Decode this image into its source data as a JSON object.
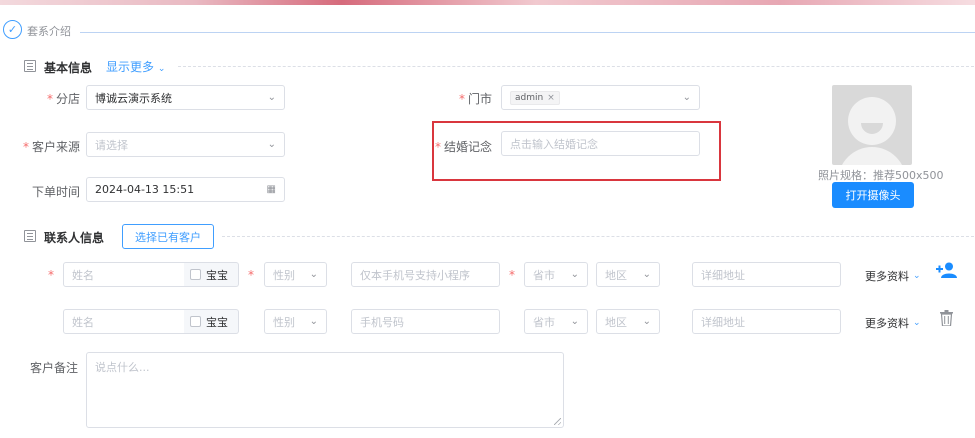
{
  "section": {
    "title": "套系介绍",
    "check_icon": "check-icon"
  },
  "basic": {
    "title": "基本信息",
    "show_more": "显示更多",
    "branch": {
      "label": "分店",
      "value": "博诚云演示系统"
    },
    "store": {
      "label": "门市",
      "tag": "admin",
      "tag_close": "×"
    },
    "source": {
      "label": "客户来源",
      "placeholder": "请选择"
    },
    "anniversary": {
      "label": "结婚记念",
      "placeholder": "点击输入结婚记念"
    },
    "order_time": {
      "label": "下单时间",
      "value": "2024-04-13 15:51"
    },
    "photo_spec": "照片规格：推荐500x500",
    "camera_button": "打开摄像头"
  },
  "contact": {
    "title": "联系人信息",
    "select_existing": "选择已有客户",
    "rows": [
      {
        "name_placeholder": "姓名",
        "baby_label": "宝宝",
        "gender_placeholder": "性别",
        "phone_placeholder": "仅本手机号支持小程序",
        "province_placeholder": "省市",
        "region_placeholder": "地区",
        "address_placeholder": "详细地址",
        "more": "更多资料"
      },
      {
        "name_placeholder": "姓名",
        "baby_label": "宝宝",
        "gender_placeholder": "性别",
        "phone_placeholder": "手机号码",
        "province_placeholder": "省市",
        "region_placeholder": "地区",
        "address_placeholder": "详细地址",
        "more": "更多资料"
      }
    ]
  },
  "remarks": {
    "label": "客户备注",
    "placeholder": "说点什么..."
  },
  "colors": {
    "primary": "#409eff",
    "button": "#1a8cff",
    "required": "#f56c6c",
    "highlight": "#d9363e"
  }
}
